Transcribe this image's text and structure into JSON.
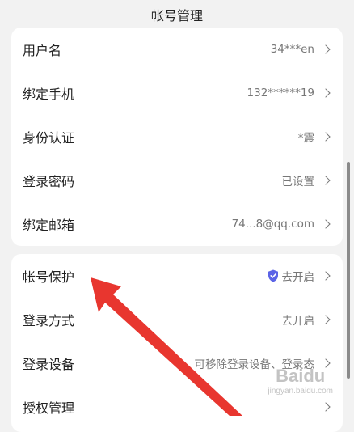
{
  "header": {
    "title": "帐号管理"
  },
  "account_card": {
    "rows": [
      {
        "label": "用户名",
        "value": "34***en"
      },
      {
        "label": "绑定手机",
        "value": "132******19"
      },
      {
        "label": "身份认证",
        "value": "*震"
      },
      {
        "label": "登录密码",
        "value": "已设置"
      },
      {
        "label": "绑定邮箱",
        "value": "74...8@qq.com"
      }
    ]
  },
  "security_card": {
    "rows": [
      {
        "label": "帐号保护",
        "value": "去开启",
        "icon": "shield-check-icon"
      },
      {
        "label": "登录方式",
        "value": "去开启"
      },
      {
        "label": "登录设备",
        "value": "可移除登录设备、登录态"
      },
      {
        "label": "授权管理",
        "value": ""
      }
    ]
  },
  "watermark": {
    "main": "Baidu",
    "sub": "jingyan.baidu.com"
  },
  "colors": {
    "background": "#f2f2f2",
    "card": "#ffffff",
    "shield": "#5b63e6",
    "annotation_arrow": "#e8362f"
  }
}
